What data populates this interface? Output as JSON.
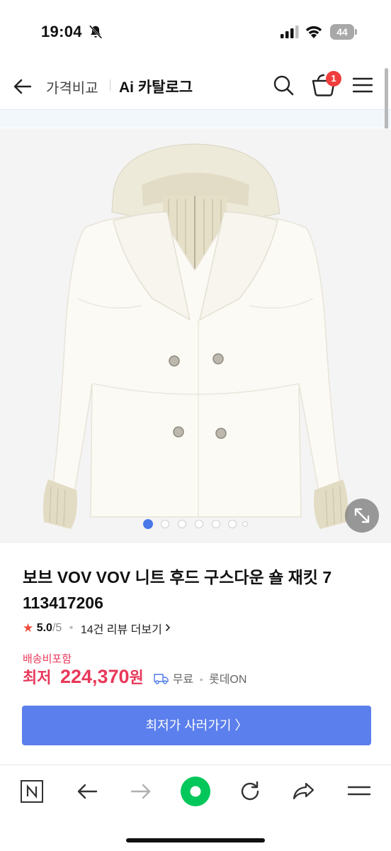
{
  "status_bar": {
    "time": "19:04",
    "battery": "44"
  },
  "header": {
    "compare_label": "가격비교",
    "title": "Ai 카탈로그",
    "cart_count": "1"
  },
  "product": {
    "title": "보브 VOV VOV 니트 후드 구스다운 숄 재킷 7 113417206",
    "image_count": 7,
    "image_index": 1,
    "rating": {
      "score": "5.0",
      "max": "/5",
      "review_link": "14건 리뷰 더보기"
    },
    "shipping_included": "배송비포함",
    "price_label": "최저",
    "price": "224,370",
    "currency": "원",
    "shipping_fee": "무료",
    "mall": "롯데ON",
    "buy_button": "최저가 사러가기 〉"
  },
  "colors": {
    "accent_red": "#e8385a",
    "button_blue": "#5b7fed",
    "dot_active": "#4a78e8",
    "badge_red": "#f03e3e",
    "star": "#f04a3a",
    "naver_green": "#03c75a"
  },
  "icons": [
    "back-arrow-icon",
    "search-icon",
    "cart-icon",
    "hamburger-menu-icon",
    "expand-icon",
    "star-icon",
    "truck-icon",
    "naver-icon",
    "back-icon",
    "forward-icon",
    "green-dot-icon",
    "reload-icon",
    "share-icon",
    "menu-icon"
  ]
}
